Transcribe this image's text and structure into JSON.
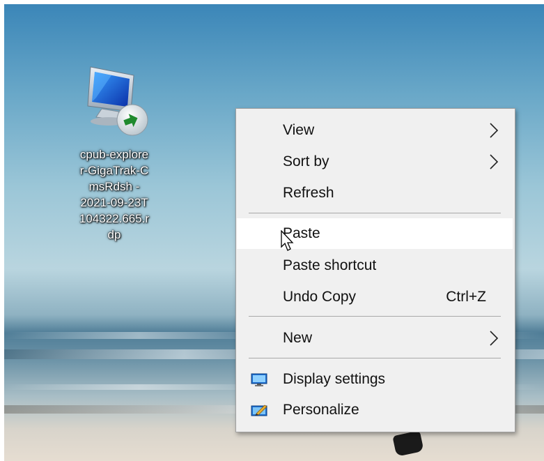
{
  "desktop": {
    "icon": {
      "name": "rdp-file-icon",
      "label_lines": [
        "cpub-explore",
        "r-GigaTrak-C",
        "msRdsh -",
        "2021-09-23T",
        "104322.665.r",
        "dp"
      ]
    }
  },
  "context_menu": {
    "items": [
      {
        "label": "View",
        "submenu": true
      },
      {
        "label": "Sort by",
        "submenu": true
      },
      {
        "label": "Refresh"
      },
      {
        "label": "Paste",
        "hovered": true
      },
      {
        "label": "Paste shortcut"
      },
      {
        "label": "Undo Copy",
        "shortcut": "Ctrl+Z"
      },
      {
        "label": "New",
        "submenu": true
      },
      {
        "label": "Display settings",
        "icon": "monitor-icon"
      },
      {
        "label": "Personalize",
        "icon": "personalize-icon"
      }
    ]
  },
  "colors": {
    "menu_bg": "#f0f0f0",
    "hover_bg": "#ffffff",
    "separator": "#a8a8a8"
  }
}
